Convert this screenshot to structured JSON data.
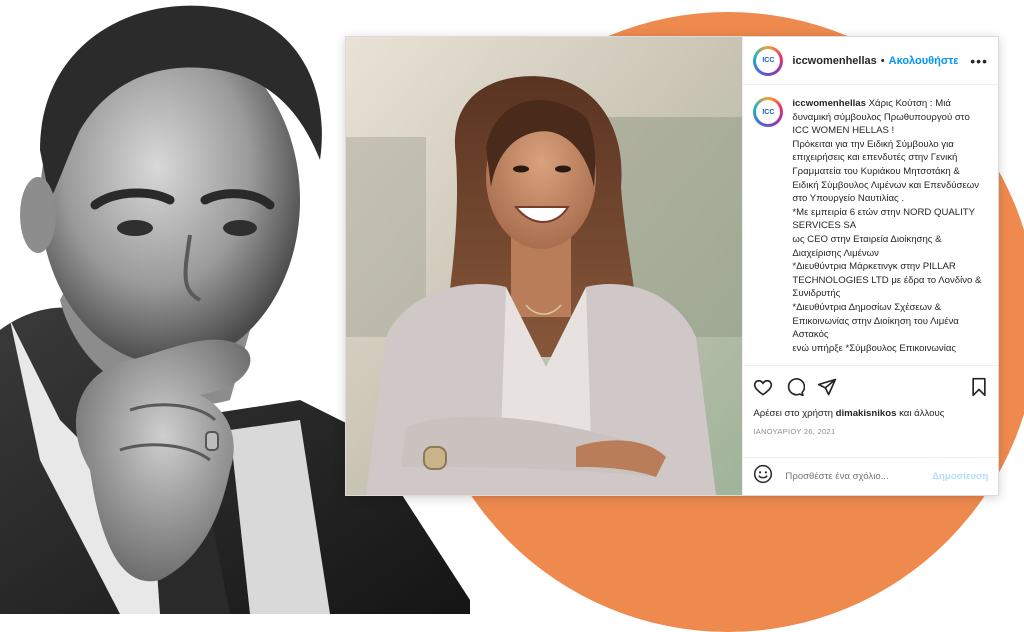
{
  "post": {
    "username": "iccwomenhellas",
    "avatar_text": "ICC",
    "separator": "•",
    "follow_label": "Ακολουθήστε",
    "more_label": "•••",
    "caption": "Χάρις Κούτση : Μιά δυναμική σύμβουλος Πρωθυπουργού στο ICC WOMEN HELLAS !\nΠρόκειται για την Ειδική Σύμβουλο για επιχειρήσεις και επενδυτές στην Γενική Γραμματεία του Κυριάκου Μητσοτάκη & Ειδική Σύμβουλος Λιμένων και Επενδύσεων στο Υπουργείο Ναυτιλίας .\n*Με εμπειρία 6 ετών στην NORD QUALITY SERVICES SA\nως CEO στην Εταιρεία Διοίκησης & Διαχείρισης Λιμένων\n*Διευθύντρια Μάρκετινγκ στην PILLAR TECHNOLOGIES LTD με έδρα το Λονδίνο & Συνιδρυτής\n*Διευθύντρια Δημοσίων Σχέσεων & Επικοινωνίας στην Διοίκηση του Λιμένα Αστακός\nενώ υπήρξε *Σύμβουλος Επικοινωνίας",
    "likes_prefix": "Αρέσει στο χρήστη",
    "likes_user": "dimakisnikos",
    "likes_suffix": "και άλλους",
    "date": "ΙΑΝΟΥΑΡΙΟΥ 26, 2021",
    "comment_placeholder": "Προσθέστε ένα σχόλιο...",
    "publish_label": "Δημοσίευση"
  },
  "icons": [
    "heart-icon",
    "comment-icon",
    "share-icon",
    "bookmark-icon",
    "emoji-icon"
  ],
  "colors": {
    "background_circle": "#ef8a4e",
    "follow_link": "#0095f6",
    "publish_disabled": "#b2dffc"
  }
}
